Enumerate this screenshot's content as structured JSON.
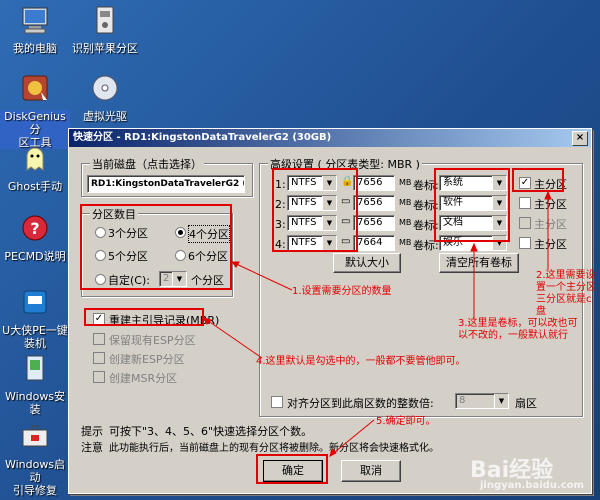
{
  "desktop": {
    "icons": [
      {
        "label": "我的电脑"
      },
      {
        "label": "识别苹果分区"
      },
      {
        "label": "DiskGenius分\n区工具"
      },
      {
        "label": "虚拟光驱"
      },
      {
        "label": "Ghost手动"
      },
      {
        "label": "PECMD说明"
      },
      {
        "label": "U大侠PE一键\n装机"
      },
      {
        "label": "Windows安装"
      },
      {
        "label": "Windows启动\n引导修复"
      }
    ]
  },
  "dialog": {
    "title": "快速分区 - RD1:KingstonDataTravelerG2 (30GB)",
    "close": "×",
    "current_disk_label": "当前磁盘（点击选择）",
    "current_disk_value": "RD1:KingstonDataTravelerG2 (",
    "partition_count_label": "分区数目",
    "options": {
      "p3": "3个分区",
      "p4": "4个分区",
      "p5": "5个分区",
      "p6": "6个分区",
      "custom": "自定(C):",
      "custom_value": "2",
      "custom_suffix": "个分区",
      "selected": "p4"
    },
    "rebuild_mbr": "重建主引导记录(MBR)",
    "keep_esp": "保留现有ESP分区",
    "create_esp": "创建新ESP分区",
    "create_msr": "创建MSR分区",
    "advanced_label": "高级设置 ( 分区表类型: MBR )",
    "rows": [
      {
        "num": "1:",
        "fs": "NTFS",
        "size": "7656",
        "unit": "MB",
        "label_word": "卷标:",
        "label": "系统",
        "primary": "主分区",
        "primary_checked": true,
        "primary_enabled": true
      },
      {
        "num": "2:",
        "fs": "NTFS",
        "size": "7656",
        "unit": "MB",
        "label_word": "卷标:",
        "label": "软件",
        "primary": "主分区",
        "primary_checked": false,
        "primary_enabled": true
      },
      {
        "num": "3:",
        "fs": "NTFS",
        "size": "7656",
        "unit": "MB",
        "label_word": "卷标:",
        "label": "文档",
        "primary": "主分区",
        "primary_checked": false,
        "primary_enabled": false
      },
      {
        "num": "4:",
        "fs": "NTFS",
        "size": "7664",
        "unit": "MB",
        "label_word": "卷标:",
        "label": "娱乐",
        "primary": "主分区",
        "primary_checked": false,
        "primary_enabled": true
      }
    ],
    "default_size_btn": "默认大小",
    "clear_labels_btn": "清空所有卷标",
    "align_label": "对齐分区到此扇区数的整数倍:",
    "align_value": "8",
    "align_unit": "扇区",
    "tip_prefix": "提示",
    "tip_text": "可按下\"3、4、5、6\"快速选择分区个数。",
    "note_prefix": "注意",
    "note_text": "此功能执行后，当前磁盘上的现有分区将被删除。新分区将会快速格式化。",
    "ok": "确定",
    "cancel": "取消"
  },
  "annotations": {
    "a1": "1.设置需要分区的数量",
    "a2": "2.这里需要设置一个主分区三分区就是c盘",
    "a3": "3.这里是卷标，可以改也可以不改的，一般默认就行",
    "a4": "4.这里默认是勾选中的，一般都不要管他即可。",
    "a5": "5.确定即可。"
  },
  "watermark": {
    "brand": "Bai经验",
    "url": "jingyan.baidu.com"
  }
}
